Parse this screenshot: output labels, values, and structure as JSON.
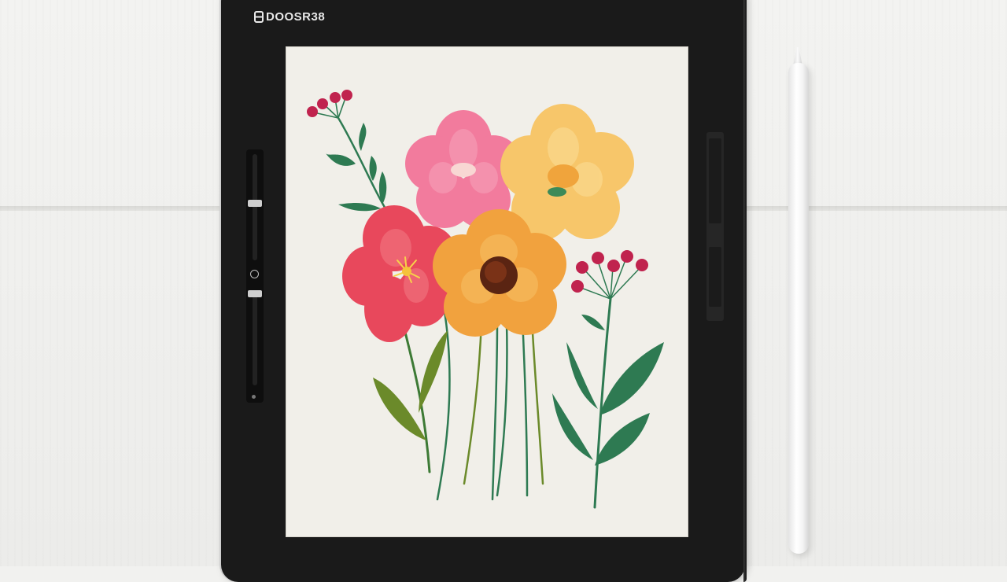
{
  "app": {
    "title": "DOOSR38"
  },
  "colors": {
    "desk": "#f1f1ef",
    "bezel": "#1a1a1a",
    "canvas": "#f1efe9",
    "pink_flower": "#f27b9d",
    "yellow_flower": "#f7c66a",
    "red_flower": "#e8485c",
    "orange_flower": "#f1a23e",
    "berry": "#c0234e",
    "leaf_green": "#2e7a52",
    "leaf_olive": "#6b8a2a"
  },
  "tools": {
    "brush_size_icon": "slider",
    "undo_icon": "circle",
    "opacity_icon": "slider"
  }
}
